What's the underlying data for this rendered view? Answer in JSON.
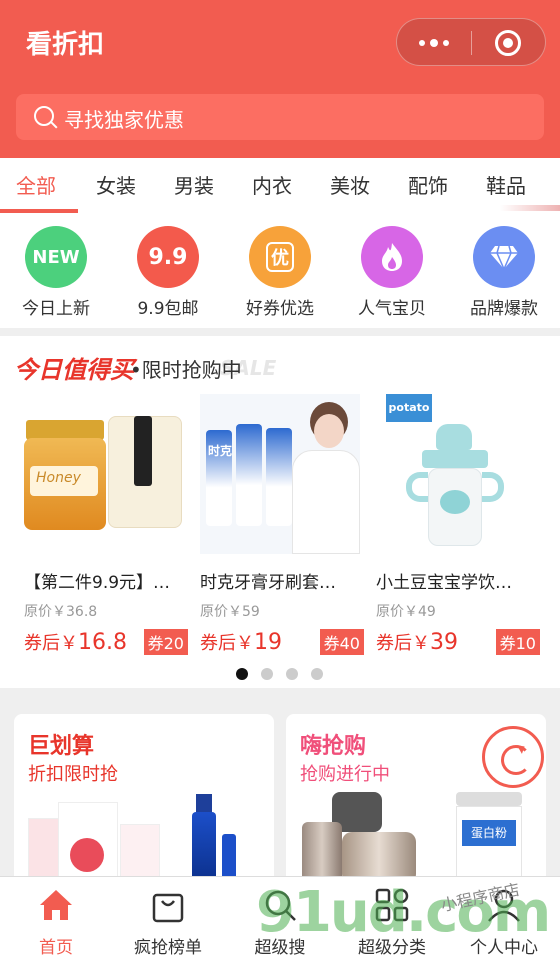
{
  "header": {
    "title": "看折扣"
  },
  "search": {
    "placeholder": "寻找独家优惠"
  },
  "tabs": [
    "全部",
    "女装",
    "男装",
    "内衣",
    "美妆",
    "配饰",
    "鞋品"
  ],
  "quick_icons": [
    {
      "label": "今日上新",
      "badge": "NEW",
      "color": "#4cd07d",
      "icon": "new-badge-icon"
    },
    {
      "label": "9.9包邮",
      "badge": "9.9",
      "color": "#f35a4c",
      "icon": "nine-nine-icon"
    },
    {
      "label": "好券优选",
      "badge": "优",
      "color": "#f7a23a",
      "icon": "coupon-icon"
    },
    {
      "label": "人气宝贝",
      "badge": "",
      "color": "#d766e6",
      "icon": "flame-icon"
    },
    {
      "label": "品牌爆款",
      "badge": "",
      "color": "#6b8ef2",
      "icon": "diamond-icon"
    }
  ],
  "today": {
    "title": "今日值得买",
    "subtitle": "•限时抢购中",
    "sale_text": "SALE",
    "products": [
      {
        "name": "【第二件9.9元】…",
        "original": "原价￥36.8",
        "price_prefix": "券后￥",
        "price": "16.8",
        "coupon": "券20"
      },
      {
        "name": "时克牙膏牙刷套…",
        "original": "原价￥59",
        "price_prefix": "券后￥",
        "price": "19",
        "coupon": "券40"
      },
      {
        "name": "小土豆宝宝学饮…",
        "original": "原价￥49",
        "price_prefix": "券后￥",
        "price": "39",
        "coupon": "券10"
      }
    ],
    "image_texts": {
      "honey": "Honey",
      "toothpaste": "时克",
      "brand": "potato"
    },
    "page_count": 4,
    "active_page": 1
  },
  "promos": [
    {
      "title": "巨划算",
      "subtitle": "折扣限时抢"
    },
    {
      "title": "嗨抢购",
      "subtitle": "抢购进行中",
      "image_label": "蛋白粉"
    }
  ],
  "bottom_nav": [
    {
      "label": "首页",
      "active": true
    },
    {
      "label": "疯抢榜单",
      "active": false
    },
    {
      "label": "超级搜",
      "active": false
    },
    {
      "label": "超级分类",
      "active": false
    },
    {
      "label": "个人中心",
      "active": false
    }
  ],
  "watermark": {
    "main": "91ud.com",
    "small": "小程序商店"
  },
  "colors": {
    "brand": "#f25c50",
    "price": "#e8352b"
  }
}
